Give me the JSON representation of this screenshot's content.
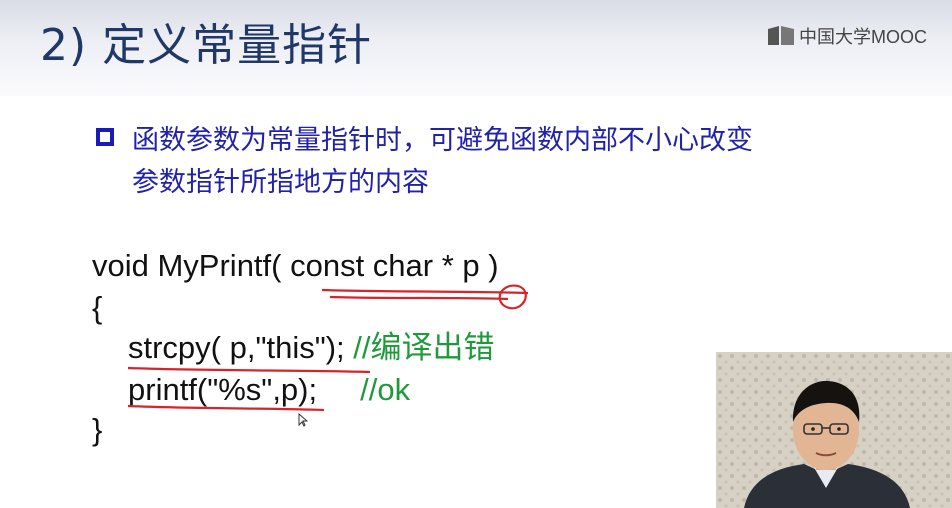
{
  "slide": {
    "title": "2) 定义常量指针",
    "logo_text": "中国大学MOOC",
    "bullet": {
      "line1": "函数参数为常量指针时，可避免函数内部不小心改变",
      "line2": "参数指针所指地方的内容"
    },
    "code": {
      "line1": "void MyPrintf( const char * p )",
      "line2": "{",
      "line3_code": "strcpy( p,\"this\"); ",
      "line3_comment": "//编译出错",
      "line4_code": "printf(\"%s\",p);     ",
      "line4_comment": "//ok",
      "line5": "}"
    }
  },
  "colors": {
    "title": "#1f3868",
    "bullet_text": "#2222a8",
    "comment": "#1e9a3a",
    "annotation": "#d8232a"
  },
  "icons": [
    "mooc-logo-icon",
    "bullet-square-icon",
    "mouse-cursor-icon"
  ]
}
